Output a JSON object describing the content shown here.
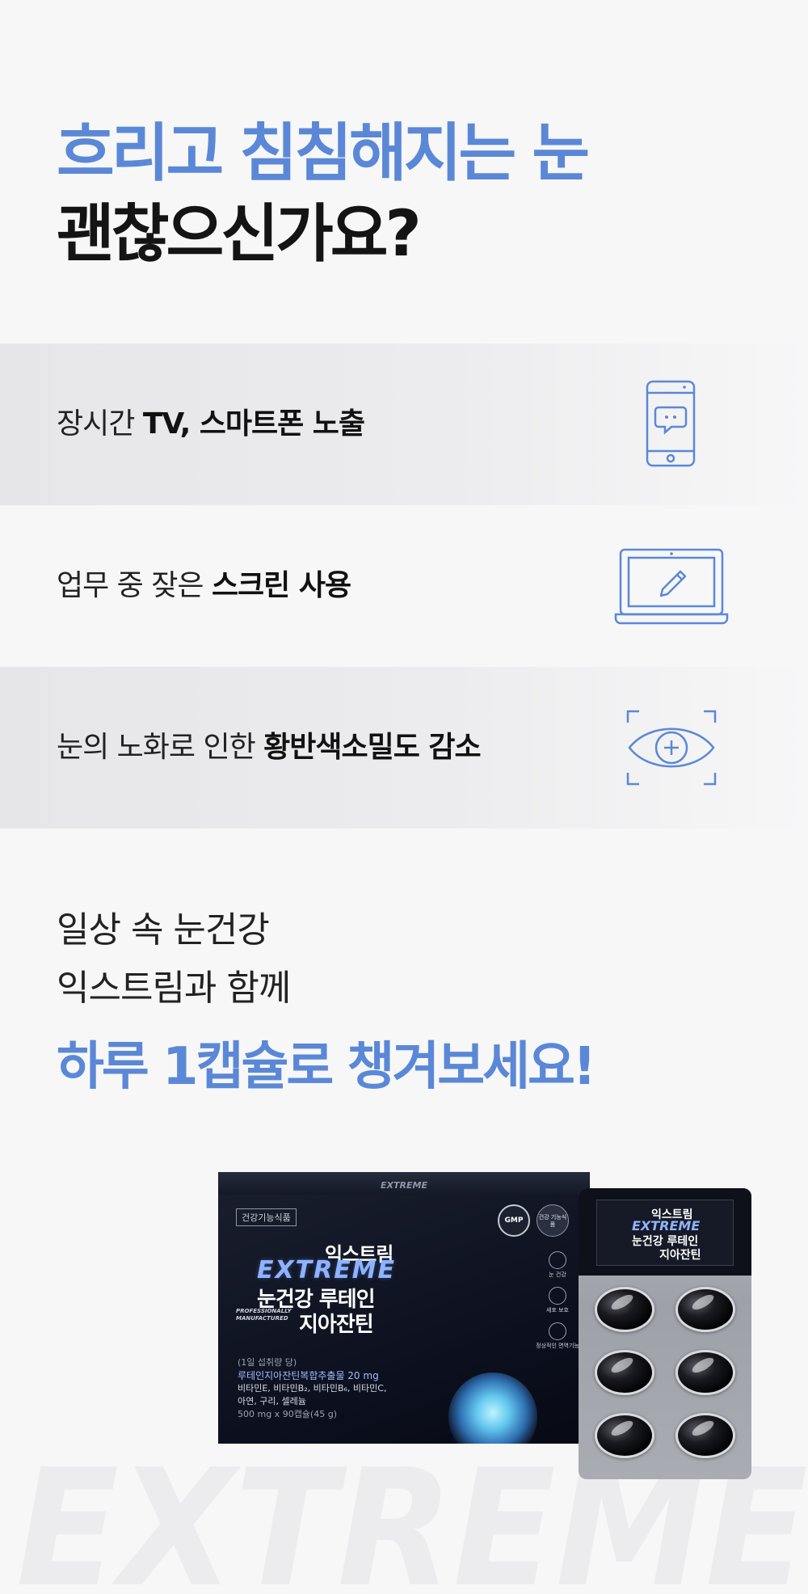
{
  "headline": {
    "line1": "흐리고 침침해지는 눈",
    "line2": "괜찮으신가요?"
  },
  "symptoms": [
    {
      "plain": "장시간 ",
      "bold": "TV, 스마트폰 노출",
      "icon": "smartphone-chat-icon"
    },
    {
      "plain": "업무 중 잦은 ",
      "bold": "스크린 사용",
      "icon": "laptop-edit-icon"
    },
    {
      "plain": "눈의 노화로 인한 ",
      "bold": "황반색소밀도 감소",
      "icon": "eye-focus-icon"
    }
  ],
  "sub": {
    "line1": "일상 속 눈건강",
    "line2": "익스트림과 함께"
  },
  "cta": "하루 1캡슐로 챙겨보세요!",
  "product": {
    "lid_brand": "EXTREME",
    "category": "건강기능식품",
    "korean_brand": "익스트림",
    "brand": "EXTREME",
    "name_line1": "눈건강 루테인",
    "name_line2": "지아잔틴",
    "professionally": "PROFESSIONALLY MANUFACTURED",
    "gmp": "GMP",
    "health_badge": "건강 기능식품",
    "side_badges": [
      "눈 건강",
      "세포 보호",
      "정상적인 면역기능"
    ],
    "dose_label": "(1일 섭취량 당)",
    "ingredient_main": "루테인지아잔틴복합추출물 20 mg",
    "ingredient_vitamins": "비타민E, 비타민B₂, 비타민B₆, 비타민C,",
    "ingredient_minerals": "아연, 구리, 셀레늄",
    "quantity": "500 mg x 90캡슐(45 g)"
  },
  "blister": {
    "korean_brand": "익스트림",
    "brand": "EXTREME",
    "name_line1": "눈건강 루테인",
    "name_line2": "지아잔틴"
  },
  "watermark": "EXTREME",
  "colors": {
    "accent": "#5b88d6",
    "dark_text": "#141414",
    "background": "#f7f7f8",
    "icon_stroke": "#5b88d6"
  }
}
